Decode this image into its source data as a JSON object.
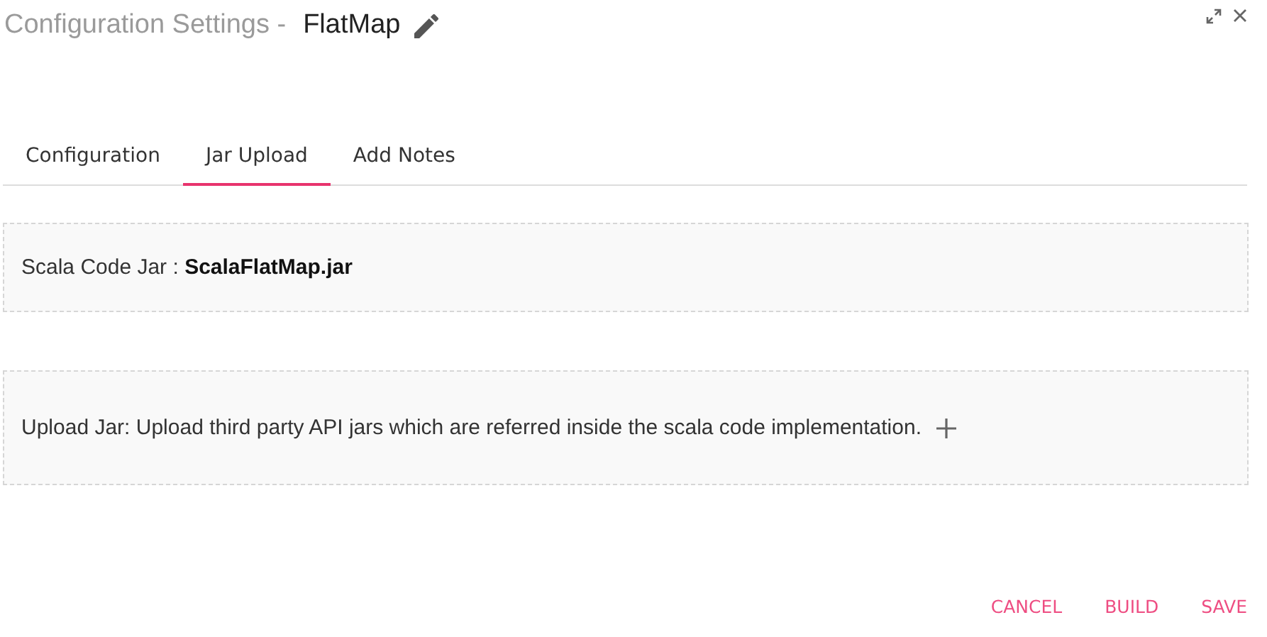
{
  "dialog": {
    "title_prefix": "Configuration Settings -",
    "title_name": "FlatMap"
  },
  "tabs": [
    {
      "label": "Configuration",
      "selected": false
    },
    {
      "label": "Jar Upload",
      "selected": true
    },
    {
      "label": "Add Notes",
      "selected": false
    }
  ],
  "scala_jar": {
    "text": "Scala Code Jar : **ScalaFlatMap.jar**"
  },
  "upload_jar": {
    "text": "Upload Jar: Upload third party API jars which are referred inside the scala code implementation."
  },
  "buttons": [
    "CANCEL",
    "BUILD",
    "SAVE"
  ]
}
